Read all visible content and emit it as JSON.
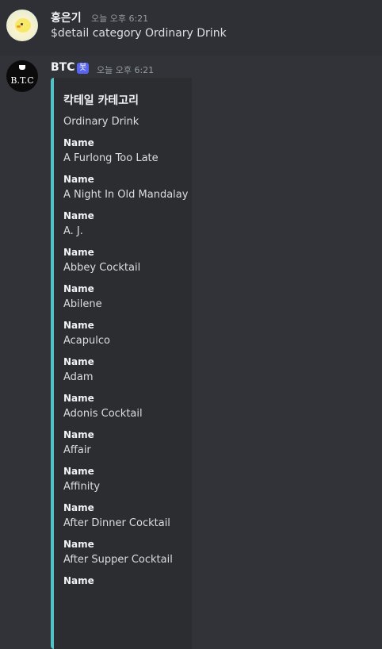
{
  "message1": {
    "author": "홍은기",
    "timestamp": "오늘 오후 6:21",
    "text": "$detail category Ordinary Drink"
  },
  "message2": {
    "author": "BTC",
    "bot_tag": "봇",
    "timestamp": "오늘 오후 6:21",
    "avatar_text": "B.T.C",
    "embed": {
      "accent_color": "#4fc3c8",
      "title": "칵테일 카테고리",
      "description": "Ordinary Drink",
      "fields": [
        {
          "name": "Name",
          "value": "A Furlong Too Late"
        },
        {
          "name": "Name",
          "value": "A Night In Old Mandalay"
        },
        {
          "name": "Name",
          "value": "A. J."
        },
        {
          "name": "Name",
          "value": "Abbey Cocktail"
        },
        {
          "name": "Name",
          "value": "Abilene"
        },
        {
          "name": "Name",
          "value": "Acapulco"
        },
        {
          "name": "Name",
          "value": "Adam"
        },
        {
          "name": "Name",
          "value": "Adonis Cocktail"
        },
        {
          "name": "Name",
          "value": "Affair"
        },
        {
          "name": "Name",
          "value": "Affinity"
        },
        {
          "name": "Name",
          "value": "After Dinner Cocktail"
        },
        {
          "name": "Name",
          "value": "After Supper Cocktail"
        },
        {
          "name": "Name",
          "value": ""
        }
      ]
    }
  }
}
